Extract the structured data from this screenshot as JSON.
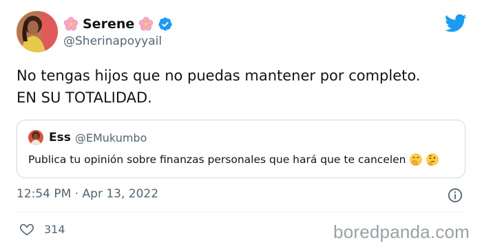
{
  "tweet": {
    "display_name": "Serene",
    "handle": "@Sherinapoyyail",
    "text_lines": [
      "No tengas hijos que no puedas mantener por completo.",
      "EN SU TOTALIDAD."
    ],
    "timestamp": "12:54 PM · Apr 13, 2022",
    "like_count": "314"
  },
  "quote": {
    "display_name": "Ess",
    "handle": "@EMukumbo",
    "text": "Publica tu opinión sobre finanzas personales que hará que te cancelen"
  },
  "icons": {
    "brand": "twitter-bird-icon",
    "verified": "verified-badge-icon",
    "flower": "cherry-blossom-emoji",
    "info": "info-icon",
    "like": "heart-icon",
    "quote_emojis": [
      "hand-over-mouth-emoji",
      "thinking-face-emoji"
    ]
  },
  "colors": {
    "twitter_blue": "#1d9bf0",
    "text_primary": "#0f1419",
    "text_secondary": "#536471",
    "border": "#cfd9de"
  },
  "watermark": "boredpanda.com"
}
